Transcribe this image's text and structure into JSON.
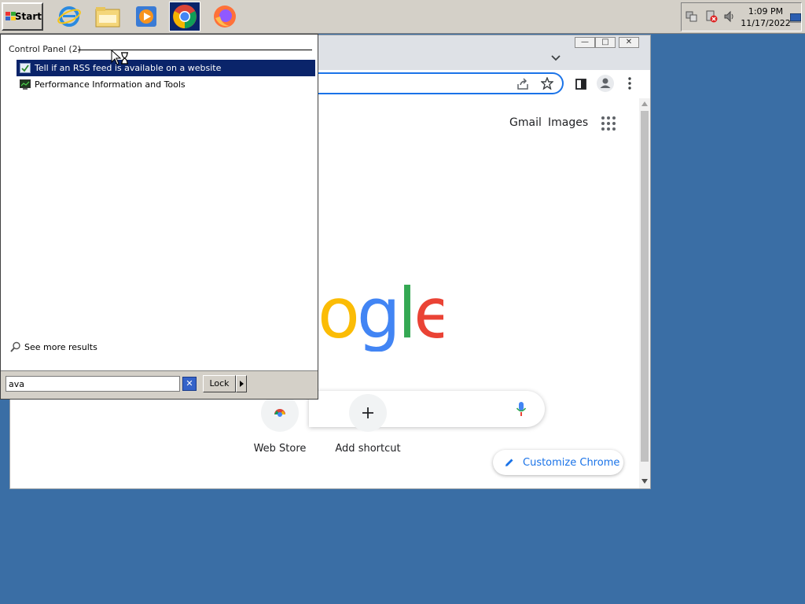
{
  "taskbar": {
    "start_label": "Start",
    "tray_time": "1:09 PM",
    "tray_date": "11/17/2022"
  },
  "browser": {
    "header_links": {
      "gmail": "Gmail",
      "images": "Images"
    },
    "logo_text": "ogle",
    "shortcuts": [
      {
        "label": "Web Store"
      },
      {
        "label": "Add shortcut"
      }
    ],
    "customize_label": "Customize Chrome"
  },
  "start_menu": {
    "section_header": "Control Panel (2)",
    "results": [
      {
        "label": "Tell if an RSS feed is available on a website",
        "selected": true
      },
      {
        "label": "Performance Information and Tools",
        "selected": false
      }
    ],
    "see_more": "See more results",
    "search_value": "ava",
    "lock_label": "Lock"
  },
  "colors": {
    "desktop": "#3a6ea5",
    "selection": "#0a246a",
    "google_blue": "#4285f4",
    "google_red": "#ea4335",
    "google_yellow": "#fbbc05",
    "google_green": "#34a853"
  }
}
